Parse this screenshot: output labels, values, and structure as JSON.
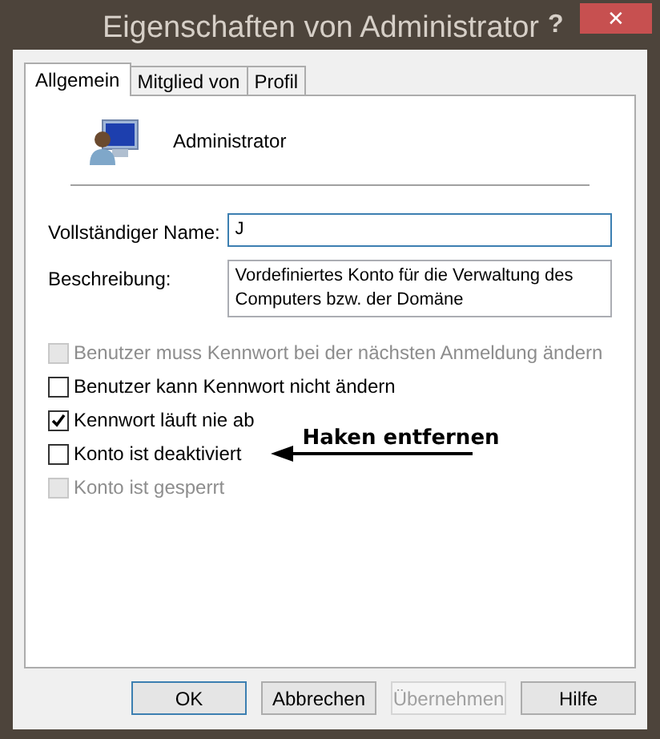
{
  "window": {
    "title": "Eigenschaften von Administrator",
    "help": "?",
    "close": "✕"
  },
  "tabs": [
    {
      "label": "Allgemein",
      "selected": true
    },
    {
      "label": "Mitglied von",
      "selected": false
    },
    {
      "label": "Profil",
      "selected": false
    }
  ],
  "account": {
    "name": "Administrator"
  },
  "fields": [
    {
      "label": "Vollständiger Name:",
      "value": "J",
      "focused": true
    },
    {
      "label": "Beschreibung:",
      "value": "Vordefiniertes Konto für die Verwaltung des Computers bzw. der Domäne",
      "focused": false
    }
  ],
  "options": [
    {
      "label": "Benutzer muss Kennwort bei der nächsten Anmeldung ändern",
      "checked": false,
      "disabled": true
    },
    {
      "label": "Benutzer kann Kennwort nicht ändern",
      "checked": false,
      "disabled": false
    },
    {
      "label": "Kennwort läuft nie ab",
      "checked": true,
      "disabled": false
    },
    {
      "label": "Konto ist deaktiviert",
      "checked": false,
      "disabled": false,
      "annotation": "Haken entfernen"
    },
    {
      "label": "Konto ist gesperrt",
      "checked": false,
      "disabled": true
    }
  ],
  "buttons": [
    {
      "label": "OK",
      "default": true,
      "disabled": false
    },
    {
      "label": "Abbrechen",
      "default": false,
      "disabled": false
    },
    {
      "label": "Übernehmen",
      "default": false,
      "disabled": true
    },
    {
      "label": "Hilfe",
      "default": false,
      "disabled": false
    }
  ]
}
